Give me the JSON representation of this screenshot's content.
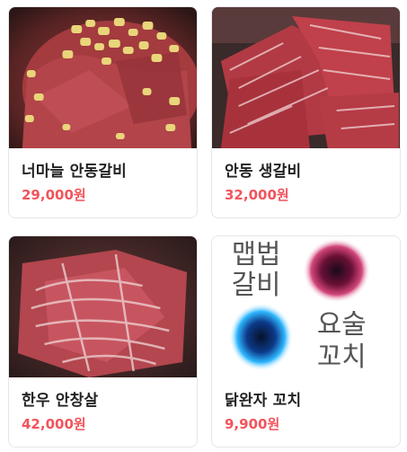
{
  "products": [
    {
      "name": "너마늘 안동갈비",
      "price": "29,000원",
      "image": "galbi-with-garlic-photo"
    },
    {
      "name": "안동 생갈비",
      "price": "32,000원",
      "image": "raw-marinated-galbi-photo"
    },
    {
      "name": "한우 안창살",
      "price": "42,000원",
      "image": "hanwoo-skirt-meat-photo"
    },
    {
      "name": "닭완자 꼬치",
      "price": "9,900원",
      "image": "brand-logo-artwork"
    }
  ],
  "logo_artwork_text": [
    "맵법",
    "갈비",
    "요술",
    "꼬치"
  ],
  "colors": {
    "price": "#f2545b",
    "title": "#222222",
    "border": "#e6e6e6"
  }
}
